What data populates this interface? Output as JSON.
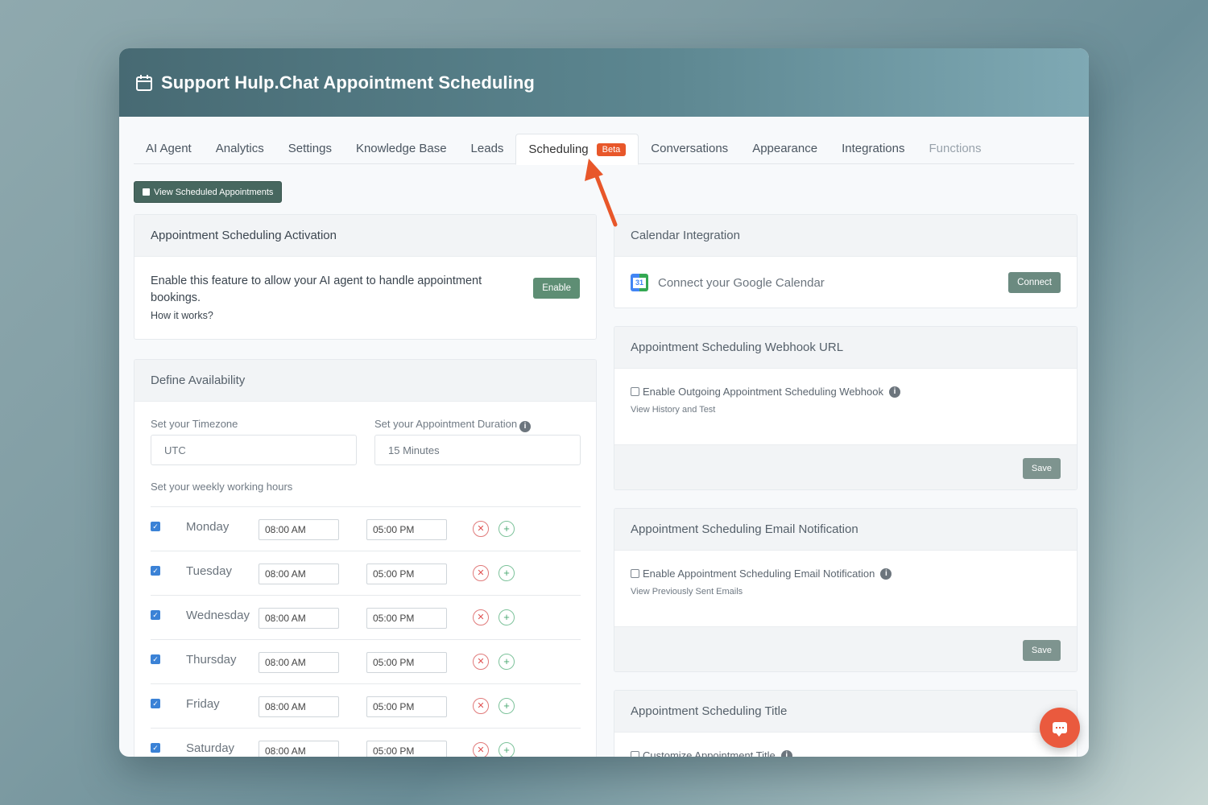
{
  "app": {
    "title": "Support Hulp.Chat Appointment Scheduling",
    "title_icon": "calendar-icon"
  },
  "tabs": [
    {
      "label": "AI Agent"
    },
    {
      "label": "Analytics"
    },
    {
      "label": "Settings"
    },
    {
      "label": "Knowledge Base"
    },
    {
      "label": "Leads"
    },
    {
      "label": "Scheduling",
      "badge": "Beta",
      "active": true
    },
    {
      "label": "Conversations"
    },
    {
      "label": "Appearance"
    },
    {
      "label": "Integrations"
    },
    {
      "label": "Functions"
    }
  ],
  "toolbar": {
    "view_appointments_label": "View Scheduled Appointments"
  },
  "activation": {
    "title": "Appointment Scheduling Activation",
    "description": "Enable this feature to allow your AI agent to handle appointment bookings.",
    "link": "How it works?",
    "enable_label": "Enable"
  },
  "availability": {
    "title": "Define Availability",
    "timezone_label": "Set your Timezone",
    "timezone_value": "UTC",
    "duration_label": "Set your Appointment Duration",
    "duration_value": "15 Minutes",
    "weekly_label": "Set your weekly working hours",
    "days": [
      {
        "day": "Monday",
        "start": "08:00 AM",
        "end": "05:00 PM",
        "checked": true
      },
      {
        "day": "Tuesday",
        "start": "08:00 AM",
        "end": "05:00 PM",
        "checked": true
      },
      {
        "day": "Wednesday",
        "start": "08:00 AM",
        "end": "05:00 PM",
        "checked": true
      },
      {
        "day": "Thursday",
        "start": "08:00 AM",
        "end": "05:00 PM",
        "checked": true
      },
      {
        "day": "Friday",
        "start": "08:00 AM",
        "end": "05:00 PM",
        "checked": true
      },
      {
        "day": "Saturday",
        "start": "08:00 AM",
        "end": "05:00 PM",
        "checked": true
      }
    ]
  },
  "calendar": {
    "title": "Calendar Integration",
    "connect_text": "Connect your Google Calendar",
    "connect_label": "Connect",
    "gcal_day": "31"
  },
  "webhook": {
    "title": "Appointment Scheduling Webhook URL",
    "checkbox_label": "Enable Outgoing Appointment Scheduling Webhook",
    "link": "View History and Test",
    "save_label": "Save"
  },
  "email": {
    "title": "Appointment Scheduling Email Notification",
    "checkbox_label": "Enable Appointment Scheduling Email Notification",
    "link": "View Previously Sent Emails",
    "save_label": "Save"
  },
  "title_card": {
    "title": "Appointment Scheduling Title",
    "checkbox_label": "Customize Appointment Title"
  },
  "colors": {
    "accent_orange": "#e8572a",
    "header_teal": "#5c8690",
    "button_green": "#5e8e74"
  }
}
